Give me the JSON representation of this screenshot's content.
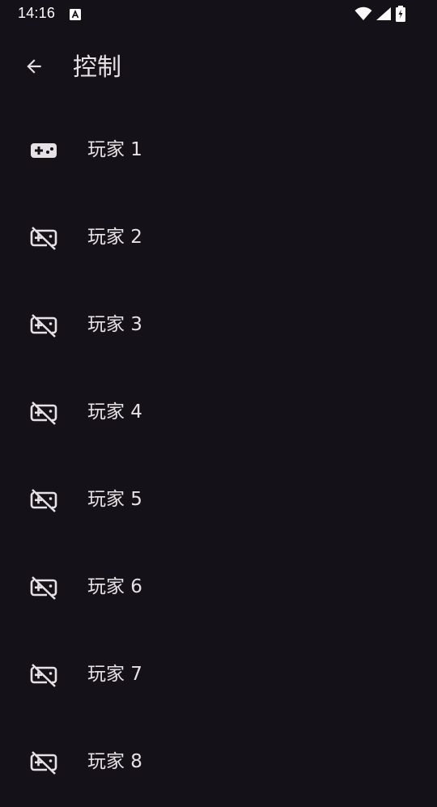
{
  "status_bar": {
    "time": "14:16",
    "icons": [
      "keyboard-a-icon",
      "wifi-icon",
      "cell-signal-icon",
      "battery-charging-icon"
    ]
  },
  "app_bar": {
    "back_icon": "arrow-back-icon",
    "title": "控制"
  },
  "players": [
    {
      "label": "玩家 1",
      "icon": "gamepad-icon",
      "connected": true
    },
    {
      "label": "玩家 2",
      "icon": "gamepad-off-icon",
      "connected": false
    },
    {
      "label": "玩家 3",
      "icon": "gamepad-off-icon",
      "connected": false
    },
    {
      "label": "玩家 4",
      "icon": "gamepad-off-icon",
      "connected": false
    },
    {
      "label": "玩家 5",
      "icon": "gamepad-off-icon",
      "connected": false
    },
    {
      "label": "玩家 6",
      "icon": "gamepad-off-icon",
      "connected": false
    },
    {
      "label": "玩家 7",
      "icon": "gamepad-off-icon",
      "connected": false
    },
    {
      "label": "玩家 8",
      "icon": "gamepad-off-icon",
      "connected": false
    }
  ],
  "colors": {
    "background": "#141218",
    "text": "#e6e1e5",
    "icon": "#e6e1e5"
  }
}
